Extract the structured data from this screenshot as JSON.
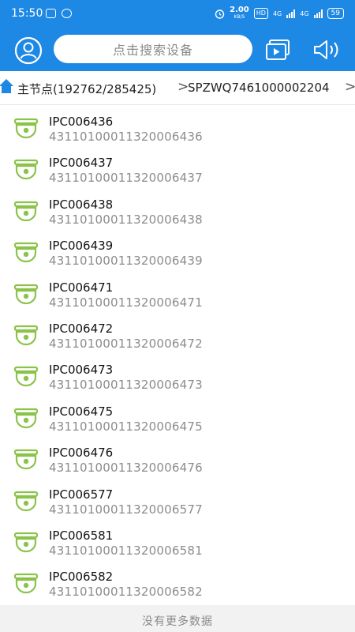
{
  "status_bar": {
    "time": "15:50",
    "net_speed_value": "2.00",
    "net_speed_unit": "KB/S",
    "hd_label": "HD",
    "signal1_label": "4G",
    "signal2_label": "4G",
    "battery": "59"
  },
  "header": {
    "search_placeholder": "点击搜索设备",
    "avatar_icon": "user-avatar-icon",
    "video_icon": "video-playback-icon",
    "speaker_icon": "speaker-icon"
  },
  "breadcrumb": {
    "root": "主节点(192762/285425)",
    "current": "SPZWQ7461000002204"
  },
  "devices": [
    {
      "name": "IPC006436",
      "code": "43110100011320006436"
    },
    {
      "name": "IPC006437",
      "code": "43110100011320006437"
    },
    {
      "name": "IPC006438",
      "code": "43110100011320006438"
    },
    {
      "name": "IPC006439",
      "code": "43110100011320006439"
    },
    {
      "name": "IPC006471",
      "code": "43110100011320006471"
    },
    {
      "name": "IPC006472",
      "code": "43110100011320006472"
    },
    {
      "name": "IPC006473",
      "code": "43110100011320006473"
    },
    {
      "name": "IPC006475",
      "code": "43110100011320006475"
    },
    {
      "name": "IPC006476",
      "code": "43110100011320006476"
    },
    {
      "name": "IPC006577",
      "code": "43110100011320006577"
    },
    {
      "name": "IPC006581",
      "code": "43110100011320006581"
    },
    {
      "name": "IPC006582",
      "code": "43110100011320006582"
    }
  ],
  "footer": {
    "text": "没有更多数据"
  },
  "colors": {
    "primary": "#1e88e5",
    "device_icon": "#8bc34a",
    "code_text": "#8c8c8c"
  }
}
